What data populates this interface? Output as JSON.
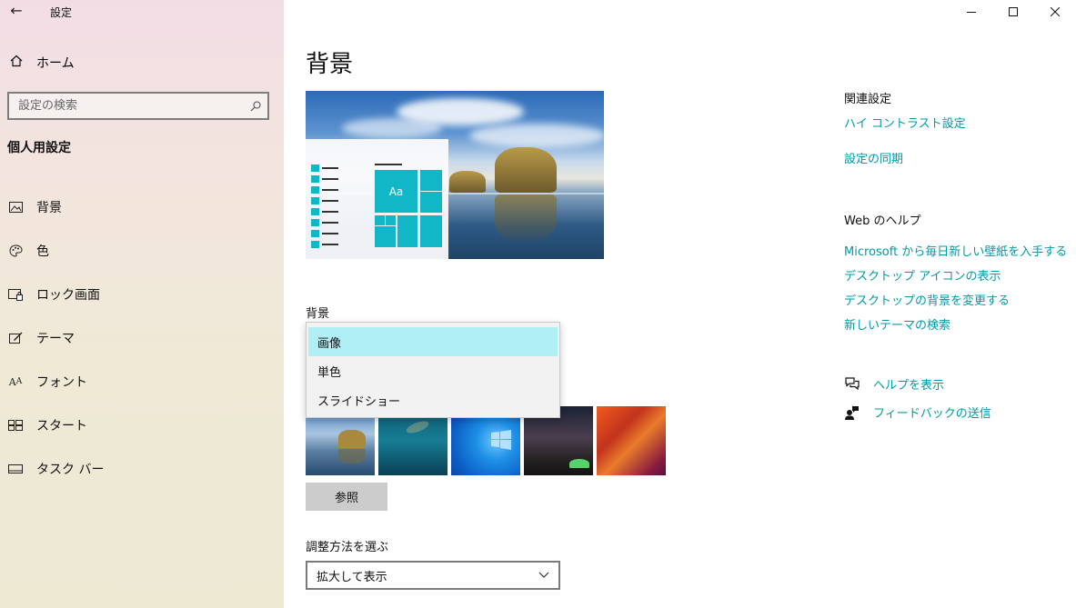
{
  "window": {
    "title": "設定",
    "back_icon": "back-arrow-icon",
    "controls": [
      "minimize-icon",
      "maximize-icon",
      "close-icon"
    ]
  },
  "sidebar": {
    "home_label": "ホーム",
    "search_placeholder": "設定の検索",
    "section_title": "個人用設定",
    "items": [
      {
        "label": "背景",
        "icon": "picture-icon"
      },
      {
        "label": "色",
        "icon": "palette-icon"
      },
      {
        "label": "ロック画面",
        "icon": "lock-screen-icon"
      },
      {
        "label": "テーマ",
        "icon": "theme-icon"
      },
      {
        "label": "フォント",
        "icon": "font-icon"
      },
      {
        "label": "スタート",
        "icon": "start-icon"
      },
      {
        "label": "タスク バー",
        "icon": "taskbar-icon"
      }
    ]
  },
  "main": {
    "title": "背景",
    "preview_tile_text": "Aa",
    "background_label": "背景",
    "background_options": [
      {
        "label": "画像",
        "selected": true
      },
      {
        "label": "単色",
        "selected": false
      },
      {
        "label": "スライドショー",
        "selected": false
      }
    ],
    "browse_label": "参照",
    "fit_label": "調整方法を選ぶ",
    "fit_value": "拡大して表示"
  },
  "related": {
    "heading": "関連設定",
    "links": [
      "ハイ コントラスト設定",
      "設定の同期"
    ]
  },
  "web_help": {
    "heading": "Web のヘルプ",
    "links": [
      "Microsoft から毎日新しい壁紙を入手する",
      "デスクトップ アイコンの表示",
      "デスクトップの背景を変更する",
      "新しいテーマの検索"
    ]
  },
  "support": {
    "help_label": "ヘルプを表示",
    "feedback_label": "フィードバックの送信"
  },
  "colors": {
    "accent": "#11b7c6",
    "link": "#0099a8",
    "selected_option": "#b0eff6"
  }
}
